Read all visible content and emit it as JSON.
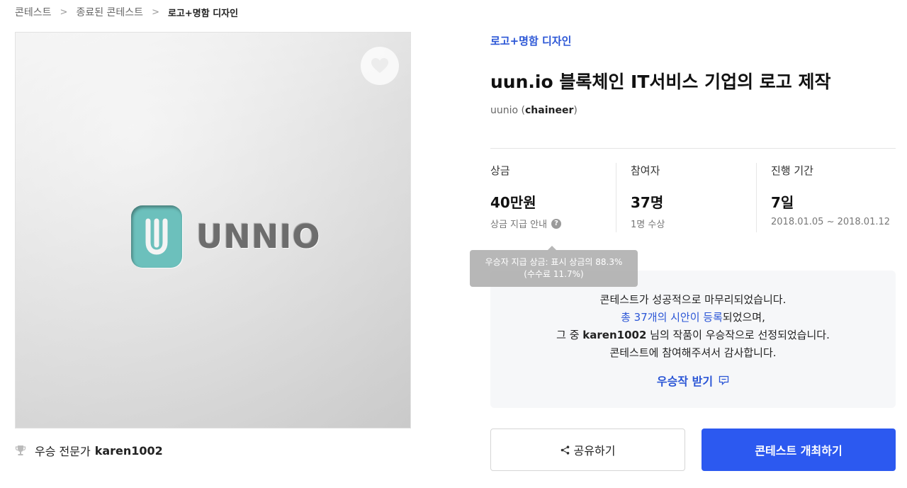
{
  "breadcrumb": {
    "items": [
      "콘테스트",
      "종료된 콘테스트"
    ],
    "current": "로고+명함 디자인",
    "separator": ">"
  },
  "hero": {
    "logo_text": "UNNIO",
    "logo_color": "#6cc0bc",
    "favorite_icon": "heart-icon"
  },
  "winner": {
    "label": "우승 전문가",
    "name": "karen1002",
    "icon": "trophy-icon"
  },
  "contest": {
    "category": "로고+명함 디자인",
    "title": "uun.io 블록체인 IT서비스 기업의 로고 제작",
    "host_name": "uunio",
    "host_id": "chaineer"
  },
  "stats": {
    "prize": {
      "label": "상금",
      "value": "40만원",
      "sub": "상금 지급 안내",
      "help": "?"
    },
    "participants": {
      "label": "참여자",
      "value": "37명",
      "sub": "1명 수상"
    },
    "period": {
      "label": "진행 기간",
      "value": "7일",
      "sub": "2018.01.05 ~ 2018.01.12"
    }
  },
  "tooltip": {
    "line1": "우승자 지급 상금: 표시 상금의 88.3%",
    "line2": "(수수료 11.7%)"
  },
  "notice": {
    "line1": "콘테스트가 성공적으로 마무리되었습니다.",
    "line2_link": "총 37개의 시안이 등록",
    "line2_rest": "되었으며,",
    "line3_pre": "그 중 ",
    "line3_name": "karen1002",
    "line3_post": " 님의 작품이 우승작으로 선정되었습니다.",
    "line4": "콘테스트에 참여해주셔서 감사합니다.",
    "receive_label": "우승작 받기"
  },
  "actions": {
    "share_label": "공유하기",
    "open_label": "콘테스트 개최하기"
  },
  "colors": {
    "accent": "#2b56d6",
    "primary_button": "#2c59f0"
  }
}
